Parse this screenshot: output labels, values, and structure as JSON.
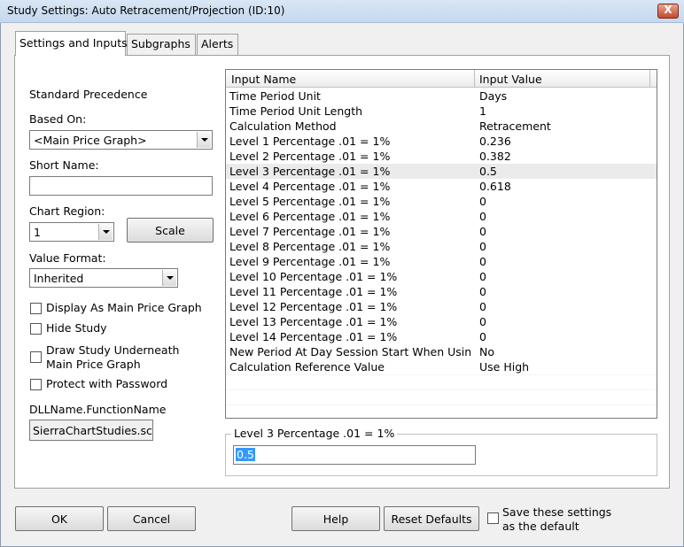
{
  "window": {
    "title": "Study Settings: Auto Retracement/Projection (ID:10)",
    "close_label": "X"
  },
  "tabs": [
    {
      "label": "Settings and Inputs"
    },
    {
      "label": "Subgraphs"
    },
    {
      "label": "Alerts"
    }
  ],
  "left": {
    "standard_precedence": "Standard Precedence",
    "based_on_label": "Based On:",
    "based_on_value": "<Main Price Graph>",
    "short_name_label": "Short Name:",
    "short_name_value": "",
    "chart_region_label": "Chart Region:",
    "chart_region_value": "1",
    "scale_button": "Scale",
    "value_format_label": "Value Format:",
    "value_format_value": "Inherited",
    "display_main_label": "Display As Main Price Graph",
    "hide_study_label": "Hide Study",
    "draw_underneath_line1": "Draw Study Underneath",
    "draw_underneath_line2": "Main Price Graph",
    "protect_label": "Protect with Password",
    "dll_label": "DLLName.FunctionName",
    "dll_value": "SierraChartStudies.scs"
  },
  "grid": {
    "col_name": "Input Name",
    "col_value": "Input Value",
    "rows": [
      {
        "name": "Time Period Unit",
        "value": "Days"
      },
      {
        "name": "Time Period Unit Length",
        "value": "1"
      },
      {
        "name": "Calculation Method",
        "value": "Retracement"
      },
      {
        "name": "Level 1 Percentage .01 = 1%",
        "value": "0.236"
      },
      {
        "name": "Level 2 Percentage .01 = 1%",
        "value": "0.382"
      },
      {
        "name": "Level 3 Percentage .01 = 1%",
        "value": "0.5"
      },
      {
        "name": "Level 4 Percentage .01 = 1%",
        "value": "0.618"
      },
      {
        "name": "Level 5 Percentage .01 = 1%",
        "value": "0"
      },
      {
        "name": "Level 6 Percentage .01 = 1%",
        "value": "0"
      },
      {
        "name": "Level 7 Percentage .01 = 1%",
        "value": "0"
      },
      {
        "name": "Level 8 Percentage .01 = 1%",
        "value": "0"
      },
      {
        "name": "Level 9 Percentage .01 = 1%",
        "value": "0"
      },
      {
        "name": "Level 10 Percentage .01 = 1%",
        "value": "0"
      },
      {
        "name": "Level 11 Percentage .01 = 1%",
        "value": "0"
      },
      {
        "name": "Level 12 Percentage .01 = 1%",
        "value": "0"
      },
      {
        "name": "Level 13 Percentage .01 = 1%",
        "value": "0"
      },
      {
        "name": "Level 14 Percentage .01 = 1%",
        "value": "0"
      },
      {
        "name": "New Period At Day Session Start When Usin...",
        "value": "No"
      },
      {
        "name": "Calculation Reference Value",
        "value": "Use High"
      }
    ],
    "selected_row": 5
  },
  "editor": {
    "label": "Level 3 Percentage .01 = 1%",
    "value": "0.5"
  },
  "footer": {
    "ok": "OK",
    "cancel": "Cancel",
    "help": "Help",
    "reset": "Reset Defaults",
    "save_line1": "Save these settings",
    "save_line2": "as the default"
  }
}
